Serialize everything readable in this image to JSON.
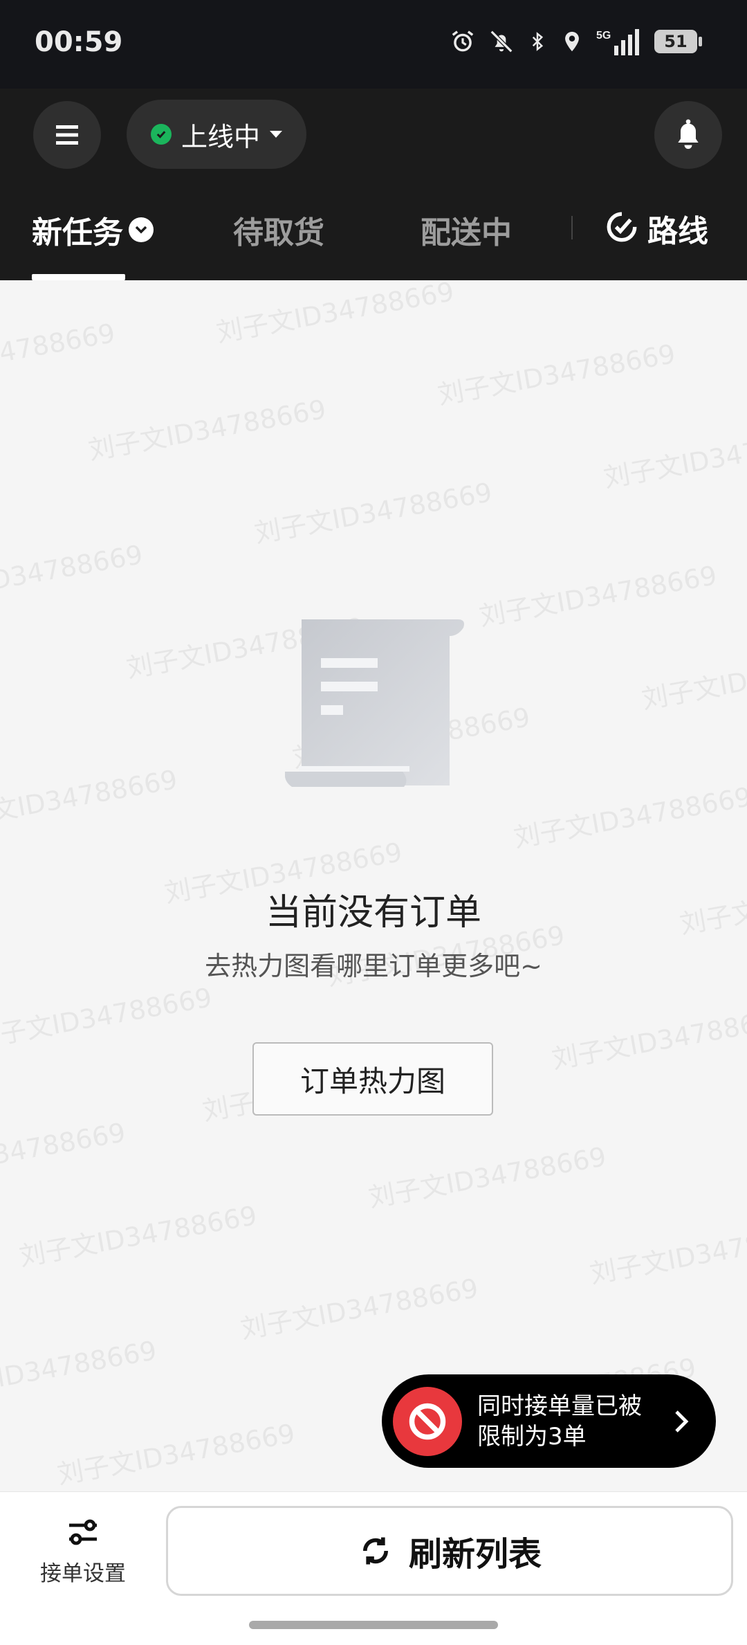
{
  "status_bar": {
    "time": "00:59",
    "battery": "51"
  },
  "header": {
    "status_label": "上线中",
    "tabs": [
      {
        "label": "新任务"
      },
      {
        "label": "待取货"
      },
      {
        "label": "配送中"
      },
      {
        "label": "路线"
      }
    ]
  },
  "empty_state": {
    "title": "当前没有订单",
    "subtitle": "去热力图看哪里订单更多吧~",
    "button_label": "订单热力图"
  },
  "toast": {
    "line1": "同时接单量已被",
    "line2": "限制为3单"
  },
  "bottom_bar": {
    "settings_label": "接单设置",
    "refresh_label": "刷新列表"
  },
  "watermark_text": "刘子文ID34788669",
  "colors": {
    "online_green": "#1bb55c",
    "alert_red": "#e8383d",
    "header_bg": "#1b1b1b"
  }
}
